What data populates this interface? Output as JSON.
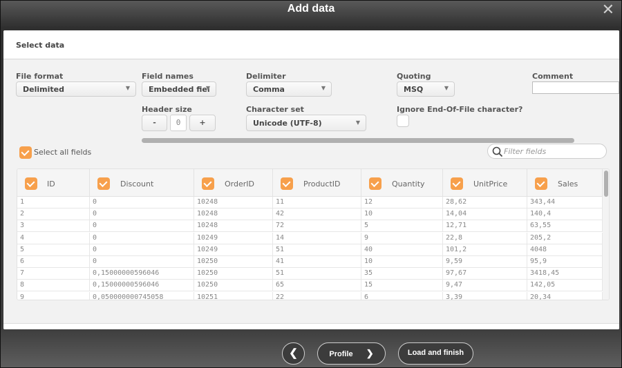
{
  "dialog": {
    "title": "Add data",
    "close_icon": "close-icon",
    "section_title": "Select data"
  },
  "options": {
    "file_format": {
      "label": "File format",
      "value": "Delimited"
    },
    "field_names": {
      "label": "Field names",
      "value": "Embedded fiel"
    },
    "delimiter": {
      "label": "Delimiter",
      "value": "Comma"
    },
    "quoting": {
      "label": "Quoting",
      "value": "MSQ"
    },
    "comment": {
      "label": "Comment",
      "value": ""
    },
    "header_size": {
      "label": "Header size",
      "value": "0",
      "minus": "-",
      "plus": "+"
    },
    "character_set": {
      "label": "Character set",
      "value": "Unicode (UTF-8)"
    },
    "ignore_eof": {
      "label": "Ignore End-Of-File character?",
      "checked": false
    }
  },
  "select_all": {
    "label": "Select all fields",
    "checked": true
  },
  "filter": {
    "placeholder": "Filter fields"
  },
  "table": {
    "columns": [
      "ID",
      "Discount",
      "OrderID",
      "ProductID",
      "Quantity",
      "UnitPrice",
      "Sales"
    ],
    "rows": [
      [
        "1",
        "0",
        "10248",
        "11",
        "12",
        "28,62",
        "343,44"
      ],
      [
        "2",
        "0",
        "10248",
        "42",
        "10",
        "14,04",
        "140,4"
      ],
      [
        "3",
        "0",
        "10248",
        "72",
        "5",
        "12,71",
        "63,55"
      ],
      [
        "4",
        "0",
        "10249",
        "14",
        "9",
        "22,8",
        "205,2"
      ],
      [
        "5",
        "0",
        "10249",
        "51",
        "40",
        "101,2",
        "4048"
      ],
      [
        "6",
        "0",
        "10250",
        "41",
        "10",
        "9,59",
        "95,9"
      ],
      [
        "7",
        "0,15000000596046",
        "10250",
        "51",
        "35",
        "97,67",
        "3418,45"
      ],
      [
        "8",
        "0,15000000596046",
        "10250",
        "65",
        "15",
        "9,47",
        "142,05"
      ],
      [
        "9",
        "0,050000000745058",
        "10251",
        "22",
        "6",
        "3,39",
        "20,34"
      ]
    ]
  },
  "footer": {
    "back_icon": "chevron-left-icon",
    "profile_label": "Profile",
    "load_label": "Load and finish"
  }
}
